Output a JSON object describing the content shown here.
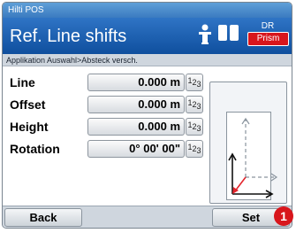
{
  "app": {
    "name": "Hilti POS"
  },
  "header": {
    "title": "Ref. Line shifts",
    "mode_label": "DR",
    "target_badge": "Prism",
    "icons": [
      "person-icon",
      "battery-icon",
      "battery-icon"
    ]
  },
  "breadcrumb": "Applikation Auswahl>Absteck versch.",
  "fields": [
    {
      "label": "Line",
      "value": "0.000 m",
      "unit_button": "123"
    },
    {
      "label": "Offset",
      "value": "0.000 m",
      "unit_button": "123"
    },
    {
      "label": "Height",
      "value": "0.000 m",
      "unit_button": "123"
    },
    {
      "label": "Rotation",
      "value": "0° 00' 00\"",
      "unit_button": "123"
    }
  ],
  "softkeys": {
    "back": "Back",
    "set": "Set"
  },
  "callout": "1",
  "colors": {
    "title_bar": "#1a5fb0",
    "accent_red": "#d8161c",
    "arrow_red": "#e3262d"
  }
}
